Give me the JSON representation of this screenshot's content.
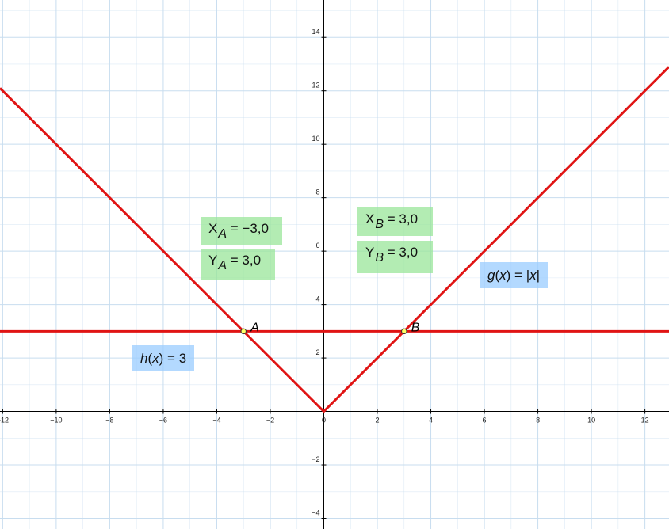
{
  "chart_data": {
    "type": "line",
    "xlim": [
      -12.1,
      12.9
    ],
    "ylim": [
      -4.4,
      15.4
    ],
    "grid": true,
    "x_ticks": [
      -12,
      -10,
      -8,
      -6,
      -4,
      -2,
      0,
      2,
      4,
      6,
      8,
      10,
      12
    ],
    "y_ticks": [
      -4,
      -2,
      2,
      4,
      6,
      8,
      10,
      12,
      14
    ],
    "series": [
      {
        "color": "#e01414",
        "x": [
          -12.1,
          0,
          12.9
        ],
        "y": [
          12.1,
          0,
          12.9
        ]
      },
      {
        "color": "#e01414",
        "x": [
          -12.1,
          12.9
        ],
        "y": [
          3,
          3
        ]
      }
    ],
    "points": [
      {
        "name": "A",
        "x": -3,
        "y": 3
      },
      {
        "name": "B",
        "x": 3,
        "y": 3
      }
    ]
  },
  "labels": {
    "xa": {
      "letter": "X",
      "sub": "A",
      "rest": " = −3,0"
    },
    "ya": {
      "letter": "Y",
      "sub": "A",
      "rest": " = 3,0"
    },
    "xb": {
      "letter": "X",
      "sub": "B",
      "rest": " = 3,0"
    },
    "yb": {
      "letter": "Y",
      "sub": "B",
      "rest": " = 3,0"
    },
    "g": {
      "name": "g",
      "open": "(",
      "arg": "x",
      "close": ")",
      "eq": " = ",
      "bar": "|",
      "val": "x"
    },
    "h": {
      "name": "h",
      "open": "(",
      "arg": "x",
      "close": ")",
      "eq": " = ",
      "val": "3"
    }
  },
  "colors": {
    "curve": "#e01414",
    "grid": "#c8ddef",
    "axis": "#000000",
    "point_fill": "#ffff66"
  }
}
